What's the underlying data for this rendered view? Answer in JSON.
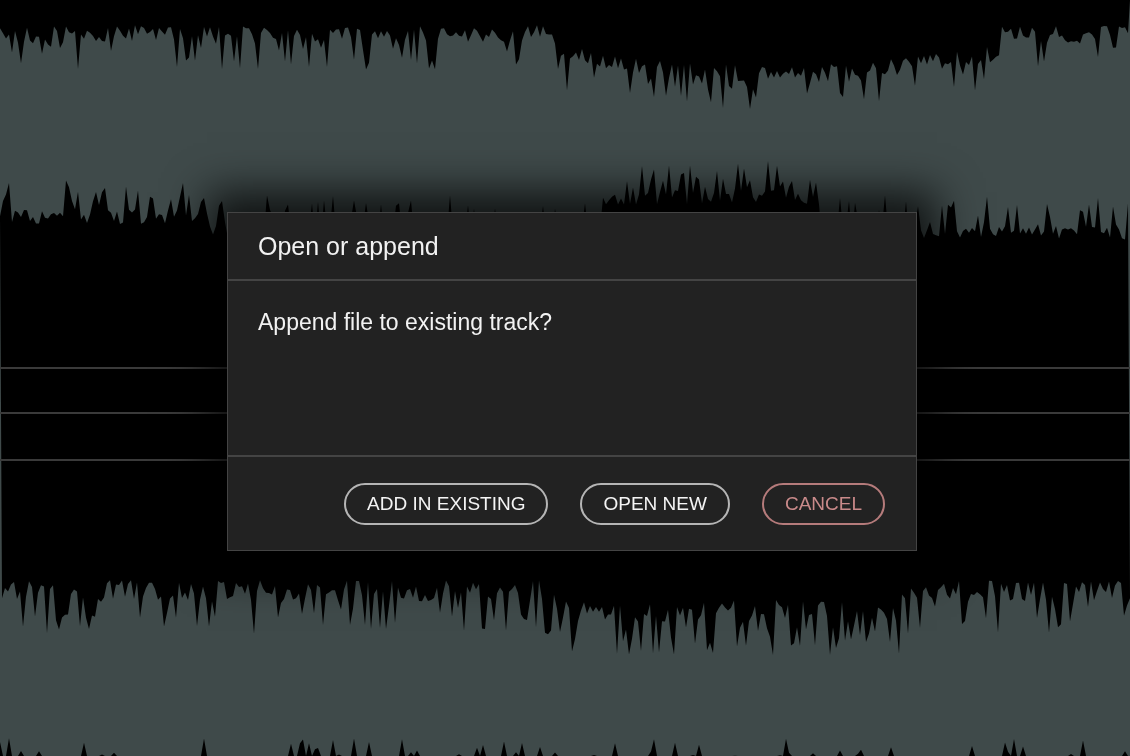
{
  "dialog": {
    "title": "Open or append",
    "message": "Append file to existing track?",
    "buttons": [
      {
        "label": "ADD IN EXISTING",
        "kind": "normal"
      },
      {
        "label": "OPEN NEW",
        "kind": "normal"
      },
      {
        "label": "CANCEL",
        "kind": "cancel"
      }
    ]
  }
}
